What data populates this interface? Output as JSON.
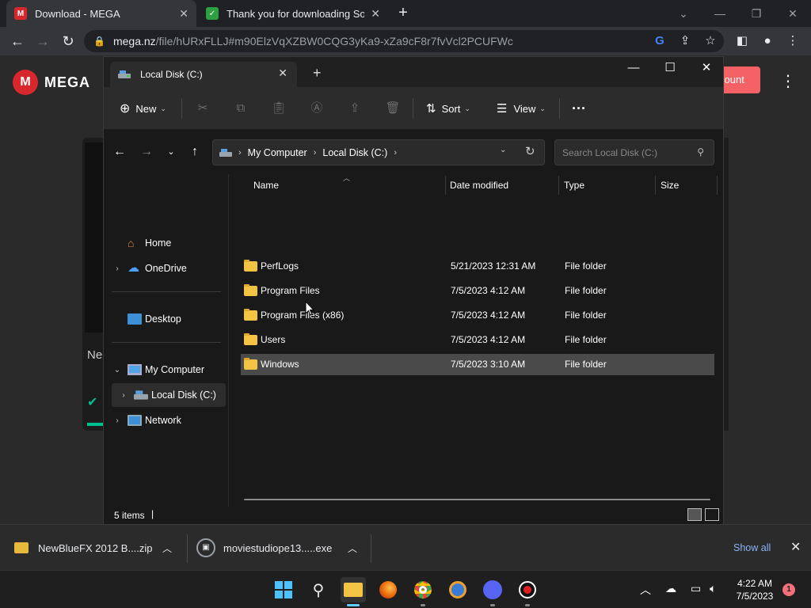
{
  "browser": {
    "tabs": [
      {
        "title": "Download - MEGA",
        "favicon_color": "#d9272e",
        "favicon_glyph": "M"
      },
      {
        "title": "Thank you for downloading Sony",
        "favicon_color": "#2ea043",
        "favicon_glyph": "✓"
      }
    ],
    "url_host": "mega.nz",
    "url_path": "/file/hURxFLLJ#m90ElzVqXZBW0CQG3yKa9-xZa9cF8r7fvVcl2PCUFWc"
  },
  "mega": {
    "logo_text": "MEGA",
    "account_button": "count",
    "side_text": "Ne",
    "brand_color": "#d9272e"
  },
  "explorer": {
    "tab_title": "Local Disk (C:)",
    "commands": {
      "new": "New",
      "sort": "Sort",
      "view": "View"
    },
    "breadcrumb": [
      "My Computer",
      "Local Disk (C:)"
    ],
    "search_placeholder": "Search Local Disk (C:)",
    "nav": {
      "home": "Home",
      "onedrive": "OneDrive",
      "desktop": "Desktop",
      "my_computer": "My Computer",
      "local_disk": "Local Disk (C:)",
      "network": "Network"
    },
    "columns": [
      "Name",
      "Date modified",
      "Type",
      "Size"
    ],
    "rows": [
      {
        "name": "PerfLogs",
        "date": "5/21/2023 12:31 AM",
        "type": "File folder"
      },
      {
        "name": "Program Files",
        "date": "7/5/2023 4:12 AM",
        "type": "File folder"
      },
      {
        "name": "Program Files (x86)",
        "date": "7/5/2023 4:12 AM",
        "type": "File folder"
      },
      {
        "name": "Users",
        "date": "7/5/2023 4:12 AM",
        "type": "File folder"
      },
      {
        "name": "Windows",
        "date": "7/5/2023 3:10 AM",
        "type": "File folder"
      }
    ],
    "selected_row": "Windows",
    "status": "5 items"
  },
  "downloads": {
    "items": [
      {
        "name": "NewBlueFX 2012 B....zip"
      },
      {
        "name": "moviestudiope13.....exe"
      }
    ],
    "show_all": "Show all"
  },
  "taskbar": {
    "time": "4:22 AM",
    "date": "7/5/2023",
    "notifications": "1"
  }
}
